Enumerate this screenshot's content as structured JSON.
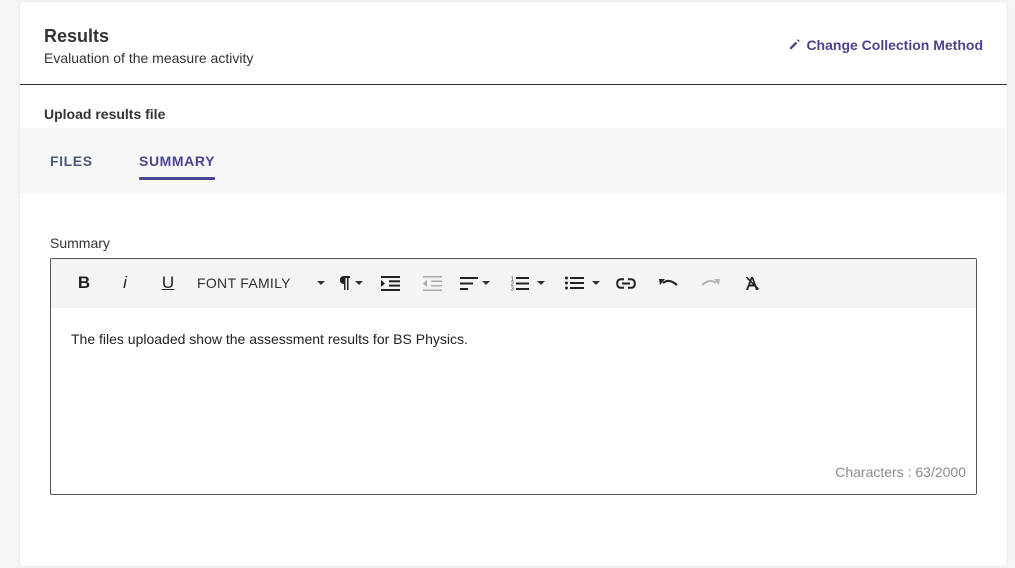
{
  "header": {
    "title": "Results",
    "subtitle": "Evaluation of the measure activity",
    "change_button_label": "Change Collection Method"
  },
  "upload": {
    "label": "Upload results file"
  },
  "tabs": [
    {
      "label": "FILES",
      "active": false
    },
    {
      "label": "SUMMARY",
      "active": true
    }
  ],
  "summary": {
    "field_label": "Summary",
    "content": "The files uploaded show the assessment results for BS Physics.",
    "char_count": "Characters : 63/2000"
  },
  "toolbar": {
    "bold_label": "B",
    "italic_label": "i",
    "underline_label": "U",
    "font_family_label": "FONT FAMILY",
    "icons": [
      "bold-icon",
      "italic-icon",
      "underline-icon",
      "font-family-dropdown",
      "paragraph-format-icon",
      "indent-icon",
      "outdent-icon",
      "align-icon",
      "ordered-list-icon",
      "unordered-list-icon",
      "link-icon",
      "undo-icon",
      "redo-icon",
      "clear-formatting-icon"
    ]
  },
  "colors": {
    "accent": "#4a4590",
    "tab_inactive": "#4f5a78",
    "toolbar_bg": "#f4f4f4",
    "char_count": "#8a8a8a"
  }
}
